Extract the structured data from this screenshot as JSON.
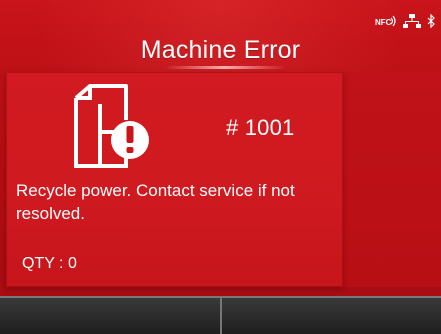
{
  "header": {
    "title": "Machine Error",
    "status_icons": [
      "nfc-icon",
      "network-icon",
      "bluetooth-icon"
    ]
  },
  "error": {
    "icon": "machine-error-icon",
    "code": "# 1001",
    "message": "Recycle power. Contact service if not resolved.",
    "qty": "QTY : 0"
  },
  "softkeys": [
    {
      "label": ""
    },
    {
      "label": ""
    }
  ],
  "colors": {
    "background_red": "#b90f14",
    "panel_red": "#d11a21",
    "text": "#ffffff",
    "softkey_bg": "#1d1d1d"
  }
}
